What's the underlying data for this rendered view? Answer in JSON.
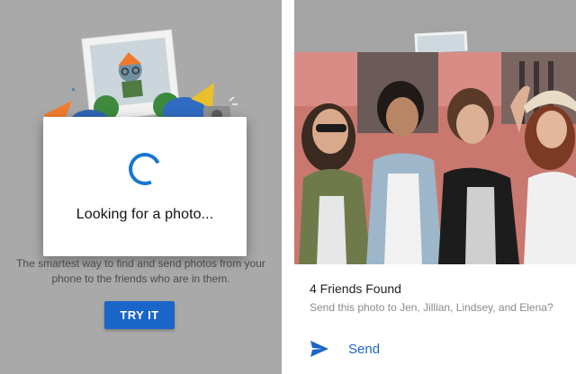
{
  "left_screen": {
    "loading": {
      "spinner_icon": "progress-spinner-icon",
      "text": "Looking for a photo..."
    },
    "description": "The smartest way to find and send photos from your phone to the friends who are in them.",
    "try_button_label": "TRY IT"
  },
  "right_screen": {
    "friends_found_title": "4 Friends Found",
    "friends_found_subtitle": "Send this photo to Jen, Jillian, Lindsey, and Elena?",
    "send_icon": "send-arrow-icon",
    "send_label": "Send"
  },
  "colors": {
    "accent_blue": "#1a66c8",
    "scrim_gray": "#a9a9a9",
    "card_white": "#ffffff"
  }
}
